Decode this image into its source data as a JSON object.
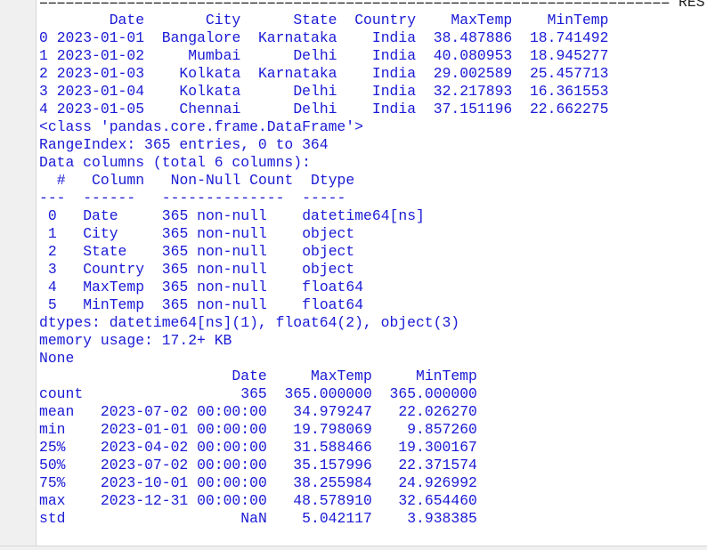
{
  "restart_line": {
    "separator": "========================================================================",
    "label": "RESTAR"
  },
  "df_head": {
    "columns": [
      "Date",
      "City",
      "State",
      "Country",
      "MaxTemp",
      "MinTemp"
    ],
    "rows": [
      {
        "index": "0",
        "Date": "2023-01-01",
        "City": "Bangalore",
        "State": "Karnataka",
        "Country": "India",
        "MaxTemp": "38.487886",
        "MinTemp": "18.741492"
      },
      {
        "index": "1",
        "Date": "2023-01-02",
        "City": "Mumbai",
        "State": "Delhi",
        "Country": "India",
        "MaxTemp": "40.080953",
        "MinTemp": "18.945277"
      },
      {
        "index": "2",
        "Date": "2023-01-03",
        "City": "Kolkata",
        "State": "Karnataka",
        "Country": "India",
        "MaxTemp": "29.002589",
        "MinTemp": "25.457713"
      },
      {
        "index": "3",
        "Date": "2023-01-04",
        "City": "Kolkata",
        "State": "Delhi",
        "Country": "India",
        "MaxTemp": "32.217893",
        "MinTemp": "16.361553"
      },
      {
        "index": "4",
        "Date": "2023-01-05",
        "City": "Chennai",
        "State": "Delhi",
        "Country": "India",
        "MaxTemp": "37.151196",
        "MinTemp": "22.662275"
      }
    ]
  },
  "info": {
    "class_line": "<class 'pandas.core.frame.DataFrame'>",
    "range_index": "RangeIndex: 365 entries, 0 to 364",
    "data_columns": "Data columns (total 6 columns):",
    "header": {
      "num": "#",
      "column": "Column",
      "count": "Non-Null Count",
      "dtype": "Dtype"
    },
    "dashes": {
      "num": "---",
      "column": "------",
      "count": "--------------",
      "dtype": "-----"
    },
    "columns": [
      {
        "num": "0",
        "name": "Date",
        "count": "365 non-null",
        "dtype": "datetime64[ns]"
      },
      {
        "num": "1",
        "name": "City",
        "count": "365 non-null",
        "dtype": "object"
      },
      {
        "num": "2",
        "name": "State",
        "count": "365 non-null",
        "dtype": "object"
      },
      {
        "num": "3",
        "name": "Country",
        "count": "365 non-null",
        "dtype": "object"
      },
      {
        "num": "4",
        "name": "MaxTemp",
        "count": "365 non-null",
        "dtype": "float64"
      },
      {
        "num": "5",
        "name": "MinTemp",
        "count": "365 non-null",
        "dtype": "float64"
      }
    ],
    "dtypes_line": "dtypes: datetime64[ns](1), float64(2), object(3)",
    "memory_line": "memory usage: 17.2+ KB"
  },
  "none_line": "None",
  "describe": {
    "columns": [
      "Date",
      "MaxTemp",
      "MinTemp"
    ],
    "rows": [
      {
        "stat": "count",
        "Date": "365",
        "MaxTemp": "365.000000",
        "MinTemp": "365.000000"
      },
      {
        "stat": "mean",
        "Date": "2023-07-02 00:00:00",
        "MaxTemp": "34.979247",
        "MinTemp": "22.026270"
      },
      {
        "stat": "min",
        "Date": "2023-01-01 00:00:00",
        "MaxTemp": "19.798069",
        "MinTemp": "9.857260"
      },
      {
        "stat": "25%",
        "Date": "2023-04-02 00:00:00",
        "MaxTemp": "31.588466",
        "MinTemp": "19.300167"
      },
      {
        "stat": "50%",
        "Date": "2023-07-02 00:00:00",
        "MaxTemp": "35.157996",
        "MinTemp": "22.371574"
      },
      {
        "stat": "75%",
        "Date": "2023-10-01 00:00:00",
        "MaxTemp": "38.255984",
        "MinTemp": "24.926992"
      },
      {
        "stat": "max",
        "Date": "2023-12-31 00:00:00",
        "MaxTemp": "48.578910",
        "MinTemp": "32.654460"
      },
      {
        "stat": "std",
        "Date": "NaN",
        "MaxTemp": "5.042117",
        "MinTemp": "3.938385"
      }
    ]
  }
}
